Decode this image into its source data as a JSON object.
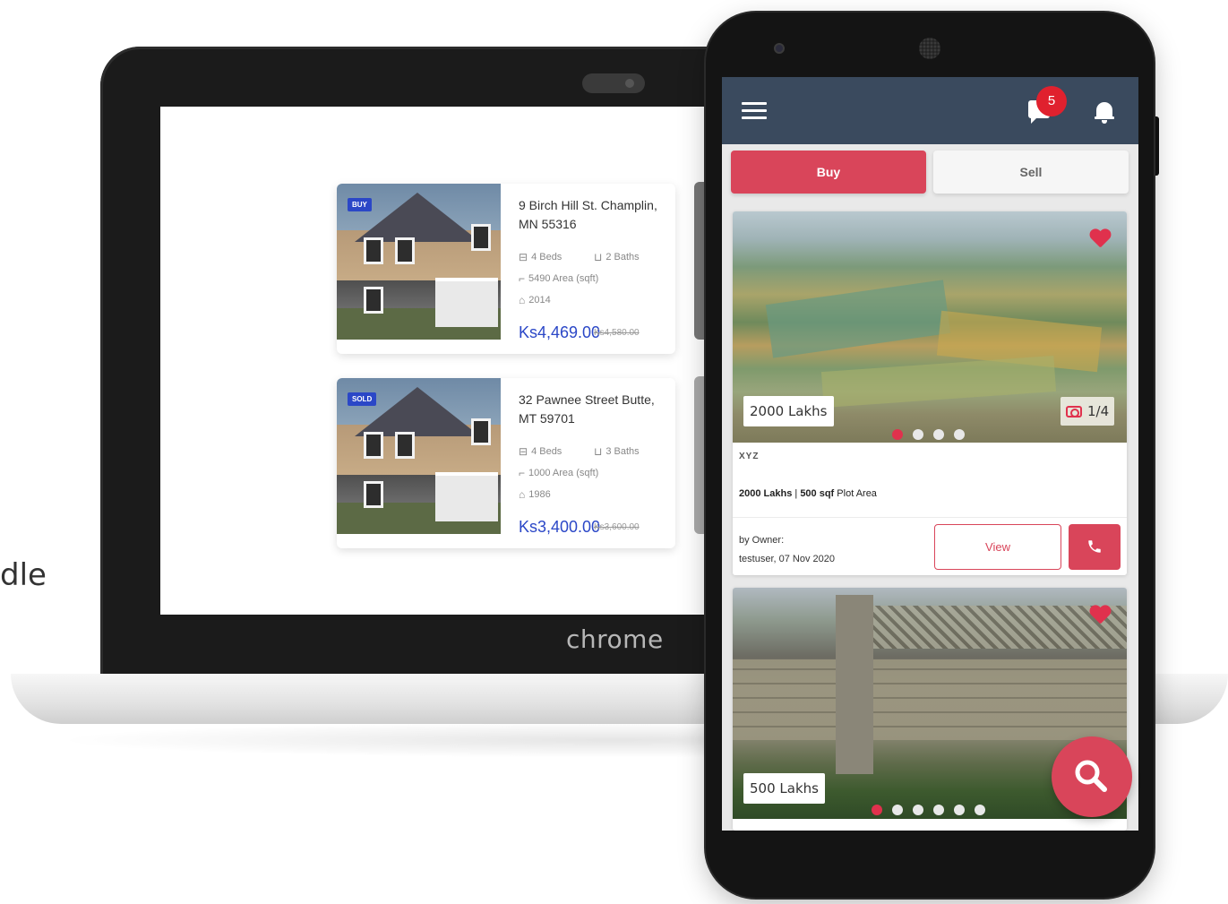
{
  "edge_text": "dle",
  "laptop": {
    "brand": "chrome",
    "listings": [
      {
        "badge": "BUY",
        "title": "9 Birch Hill St. Champlin, MN 55316",
        "beds": "4 Beds",
        "baths": "2 Baths",
        "area": "5490 Area (sqft)",
        "year": "2014",
        "price": "Ks4,469.00",
        "old_price": "Ks4,580.00"
      },
      {
        "badge": "SOLD",
        "title": "32 Pawnee Street Butte, MT 59701",
        "beds": "4 Beds",
        "baths": "3 Baths",
        "area": "1000 Area (sqft)",
        "year": "1986",
        "price": "Ks3,400.00",
        "old_price": "Ks3,600.00"
      }
    ]
  },
  "phone": {
    "appbar": {
      "menu_icon": "hamburger-menu-icon",
      "chat_icon": "chat-icon",
      "chat_badge": "5",
      "bell_icon": "bell-icon",
      "color": "#3a4a5e"
    },
    "tabs": {
      "buy": "Buy",
      "sell": "Sell",
      "active": "buy",
      "accent": "#d9455a"
    },
    "cards": [
      {
        "price_tag": "2000  Lakhs",
        "photo_count": "1/4",
        "dots": 4,
        "active_dot": 0,
        "name": "XYZ",
        "meta_bold": "2000 Lakhs",
        "meta_sep": " | ",
        "meta_size": "500 sqf",
        "meta_rest": " Plot Area",
        "owner_label": "by Owner:",
        "owner_info": "testuser,  07 Nov 2020",
        "view_label": "View",
        "call_icon": "phone-icon",
        "favorite_icon": "heart-icon"
      },
      {
        "price_tag": "500  Lakhs",
        "dots": 6,
        "active_dot": 0,
        "favorite_icon": "heart-icon"
      }
    ],
    "fab_icon": "search-icon"
  }
}
